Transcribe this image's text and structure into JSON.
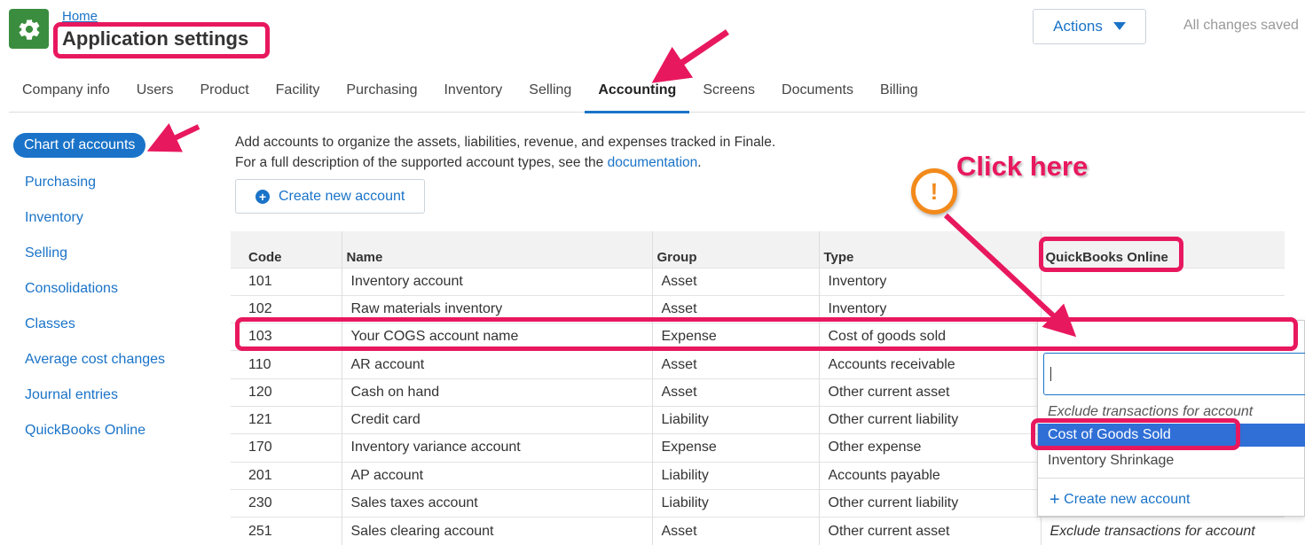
{
  "header": {
    "breadcrumb_home": "Home",
    "title": "Application settings",
    "actions_label": "Actions",
    "save_status": "All changes saved"
  },
  "tabs": [
    "Company info",
    "Users",
    "Product",
    "Facility",
    "Purchasing",
    "Inventory",
    "Selling",
    "Accounting",
    "Screens",
    "Documents",
    "Billing"
  ],
  "active_tab": "Accounting",
  "sidebar": {
    "items": [
      "Chart of accounts",
      "Purchasing",
      "Inventory",
      "Selling",
      "Consolidations",
      "Classes",
      "Average cost changes",
      "Journal entries",
      "QuickBooks Online"
    ],
    "active": "Chart of accounts"
  },
  "content": {
    "description_line1": "Add accounts to organize the assets, liabilities, revenue, and expenses tracked in Finale.",
    "description_line2_prefix": "For a full description of the supported account types, see the ",
    "description_link": "documentation",
    "description_suffix": ".",
    "create_button": "Create new account"
  },
  "table": {
    "columns": [
      "Code",
      "Name",
      "Group",
      "Type",
      "QuickBooks Online"
    ],
    "rows": [
      [
        "101",
        "Inventory account",
        "Asset",
        "Inventory",
        ""
      ],
      [
        "102",
        "Raw materials inventory",
        "Asset",
        "Inventory",
        ""
      ],
      [
        "103",
        "Your COGS account name",
        "Expense",
        "Cost of goods sold",
        ""
      ],
      [
        "110",
        "AR account",
        "Asset",
        "Accounts receivable",
        ""
      ],
      [
        "120",
        "Cash on hand",
        "Asset",
        "Other current asset",
        ""
      ],
      [
        "121",
        "Credit card",
        "Liability",
        "Other current liability",
        ""
      ],
      [
        "170",
        "Inventory variance account",
        "Expense",
        "Other expense",
        ""
      ],
      [
        "201",
        "AP account",
        "Liability",
        "Accounts payable",
        ""
      ],
      [
        "230",
        "Sales taxes account",
        "Liability",
        "Other current liability",
        ""
      ],
      [
        "251",
        "Sales clearing account",
        "Asset",
        "Other current asset",
        "Exclude transactions for account"
      ]
    ]
  },
  "dropdown": {
    "search_value": "",
    "options": [
      "Exclude transactions for account",
      "Cost of Goods Sold",
      "Inventory Shrinkage"
    ],
    "selected": "Cost of Goods Sold",
    "create_label": "Create new account"
  },
  "annotation": {
    "callout": "Click here",
    "warn_symbol": "!"
  },
  "colors": {
    "accent": "#1a73c8",
    "highlight": "#e8185f",
    "brand_green": "#3a8d3e",
    "warning": "#f28a1b",
    "selected_option": "#2f6fd6"
  }
}
